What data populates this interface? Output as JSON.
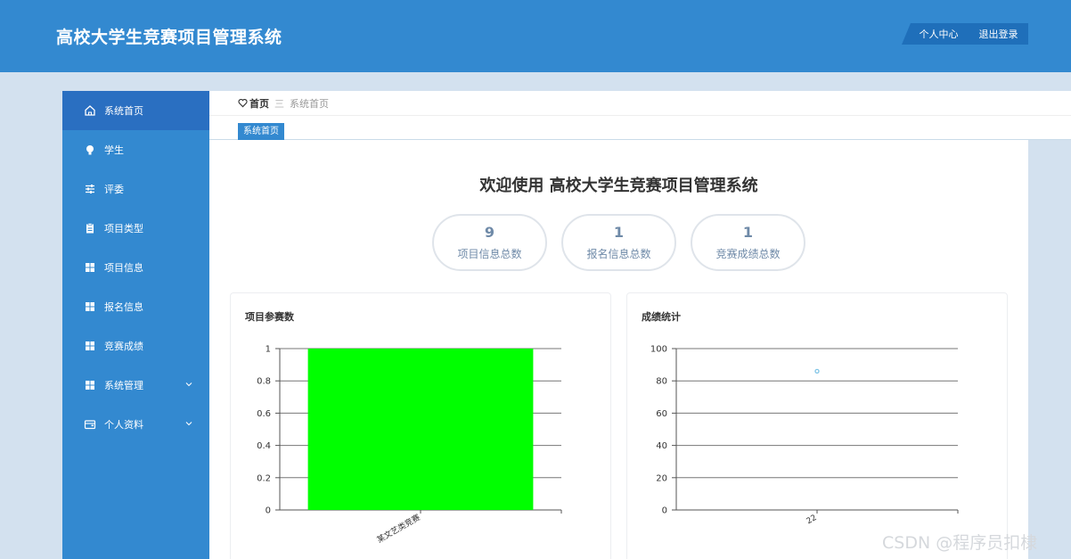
{
  "header": {
    "app_title": "高校大学生竞赛项目管理系统",
    "personal_center": "个人中心",
    "logout": "退出登录"
  },
  "sidebar": {
    "items": [
      {
        "label": "系统首页",
        "icon": "home-icon",
        "active": true
      },
      {
        "label": "学生",
        "icon": "bulb-icon"
      },
      {
        "label": "评委",
        "icon": "sliders-icon"
      },
      {
        "label": "项目类型",
        "icon": "clipboard-icon"
      },
      {
        "label": "项目信息",
        "icon": "grid-icon"
      },
      {
        "label": "报名信息",
        "icon": "grid-icon"
      },
      {
        "label": "竞赛成绩",
        "icon": "grid-icon"
      },
      {
        "label": "系统管理",
        "icon": "grid-icon",
        "expandable": true
      },
      {
        "label": "个人资料",
        "icon": "wallet-icon",
        "expandable": true
      }
    ]
  },
  "breadcrumb": {
    "home": "首页",
    "separator": "三",
    "current": "系统首页"
  },
  "tabs": [
    {
      "label": "系统首页"
    }
  ],
  "main": {
    "welcome": "欢迎使用 高校大学生竞赛项目管理系统",
    "stats": [
      {
        "value": "9",
        "label": "项目信息总数"
      },
      {
        "value": "1",
        "label": "报名信息总数"
      },
      {
        "value": "1",
        "label": "竞赛成绩总数"
      }
    ]
  },
  "colors": {
    "header_blue": "#3389d0",
    "active_blue": "#2a6fc1",
    "bar_green": "#00ff00",
    "point_blue": "#7ec4e6"
  },
  "chart_data": [
    {
      "type": "bar",
      "title": "项目参赛数",
      "categories": [
        "某文艺类竞赛"
      ],
      "values": [
        1
      ],
      "ylim": [
        0,
        1
      ],
      "yticks": [
        "0",
        "0.2",
        "0.4",
        "0.6",
        "0.8",
        "1"
      ],
      "grid": true
    },
    {
      "type": "scatter",
      "title": "成绩统计",
      "categories": [
        "22"
      ],
      "values": [
        86
      ],
      "ylim": [
        0,
        100
      ],
      "yticks": [
        "0",
        "20",
        "40",
        "60",
        "80",
        "100"
      ],
      "grid": true
    }
  ],
  "watermark": "CSDN @程序员扣棣"
}
